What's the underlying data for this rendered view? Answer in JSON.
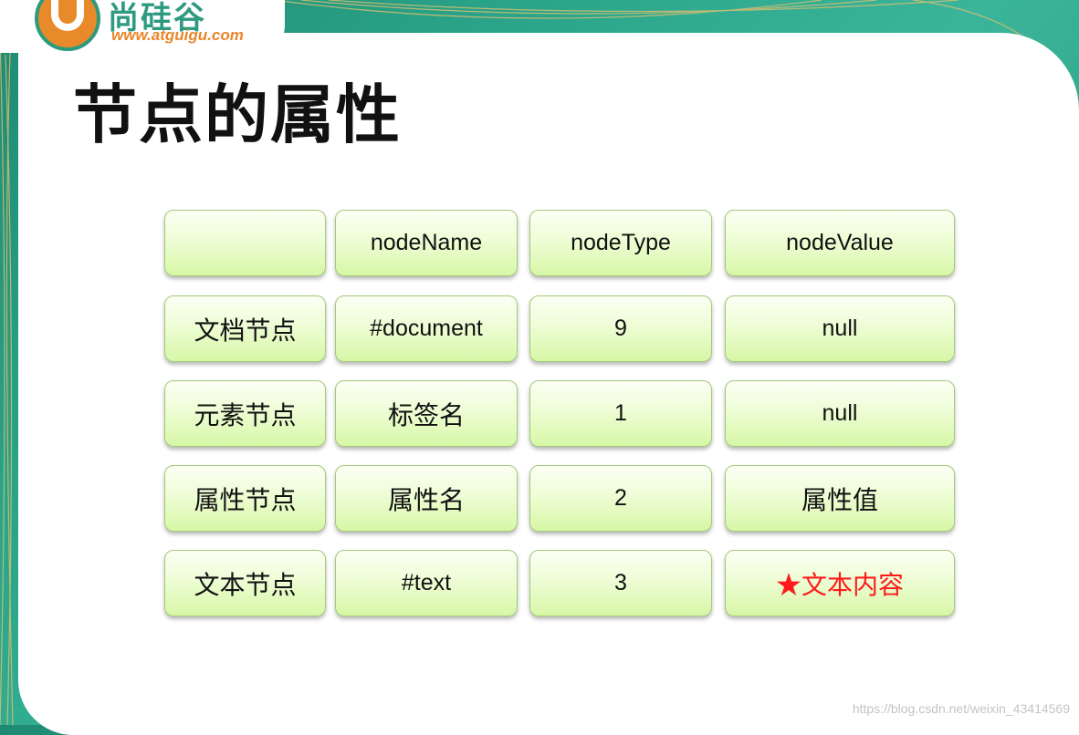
{
  "logo": {
    "brand": "尚硅谷",
    "url": "www.atguigu.com"
  },
  "title": "节点的属性",
  "table": {
    "header": [
      "",
      "nodeName",
      "nodeType",
      "nodeValue"
    ],
    "rows": [
      [
        "文档节点",
        "#document",
        "9",
        "null"
      ],
      [
        "元素节点",
        "标签名",
        "1",
        "null"
      ],
      [
        "属性节点",
        "属性名",
        "2",
        "属性值"
      ],
      [
        "文本节点",
        "#text",
        "3",
        "★文本内容"
      ]
    ]
  },
  "watermark": "https://blog.csdn.net/weixin_43414569",
  "colors": {
    "frame": "#2ba58a",
    "cell_border": "#a3c97a",
    "cell_fill_bottom": "#d7f7a6",
    "highlight_text": "#ff1a1a",
    "logo_orange": "#e88a2a"
  }
}
